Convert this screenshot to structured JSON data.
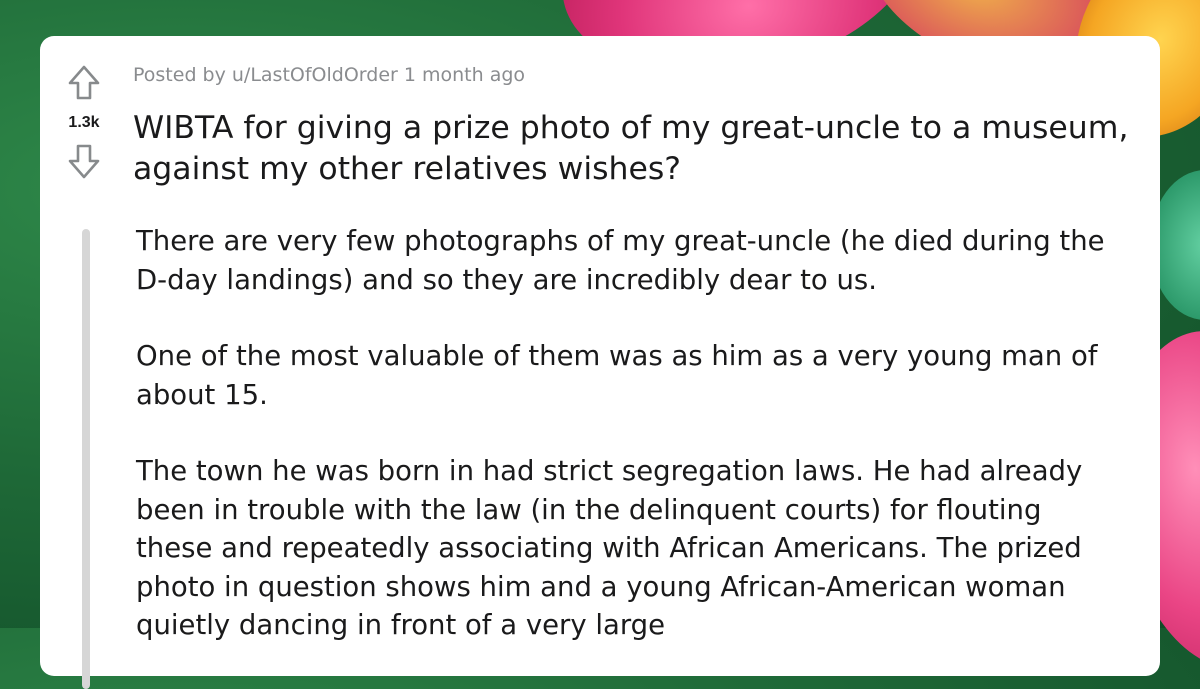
{
  "post": {
    "author_line": "Posted by u/LastOfOldOrder 1 month ago",
    "vote_count": "1.3k",
    "title": "WIBTA for giving a prize photo of my great-uncle to a museum, against my other relatives wishes?",
    "paragraphs": [
      "There are very few photographs of my great-uncle (he died during the D-day landings) and so they are incredibly dear to us.",
      "One of the most valuable of them was as him as a very young man of about 15.",
      "The town he was born in had strict segregation laws. He had already been in trouble with the law (in the delinquent courts) for flouting these and repeatedly associating with African Americans. The prized photo in question shows him and a young African-American woman quietly dancing in front of a very large"
    ]
  },
  "icons": {
    "upvote": "arrow-up-icon",
    "downvote": "arrow-down-icon"
  },
  "colors": {
    "card_bg": "#ffffff",
    "text": "#1a1a1b",
    "meta_text": "#8a8c8f",
    "arrow": "#878a8c",
    "thread_line": "#d6d6d6"
  }
}
